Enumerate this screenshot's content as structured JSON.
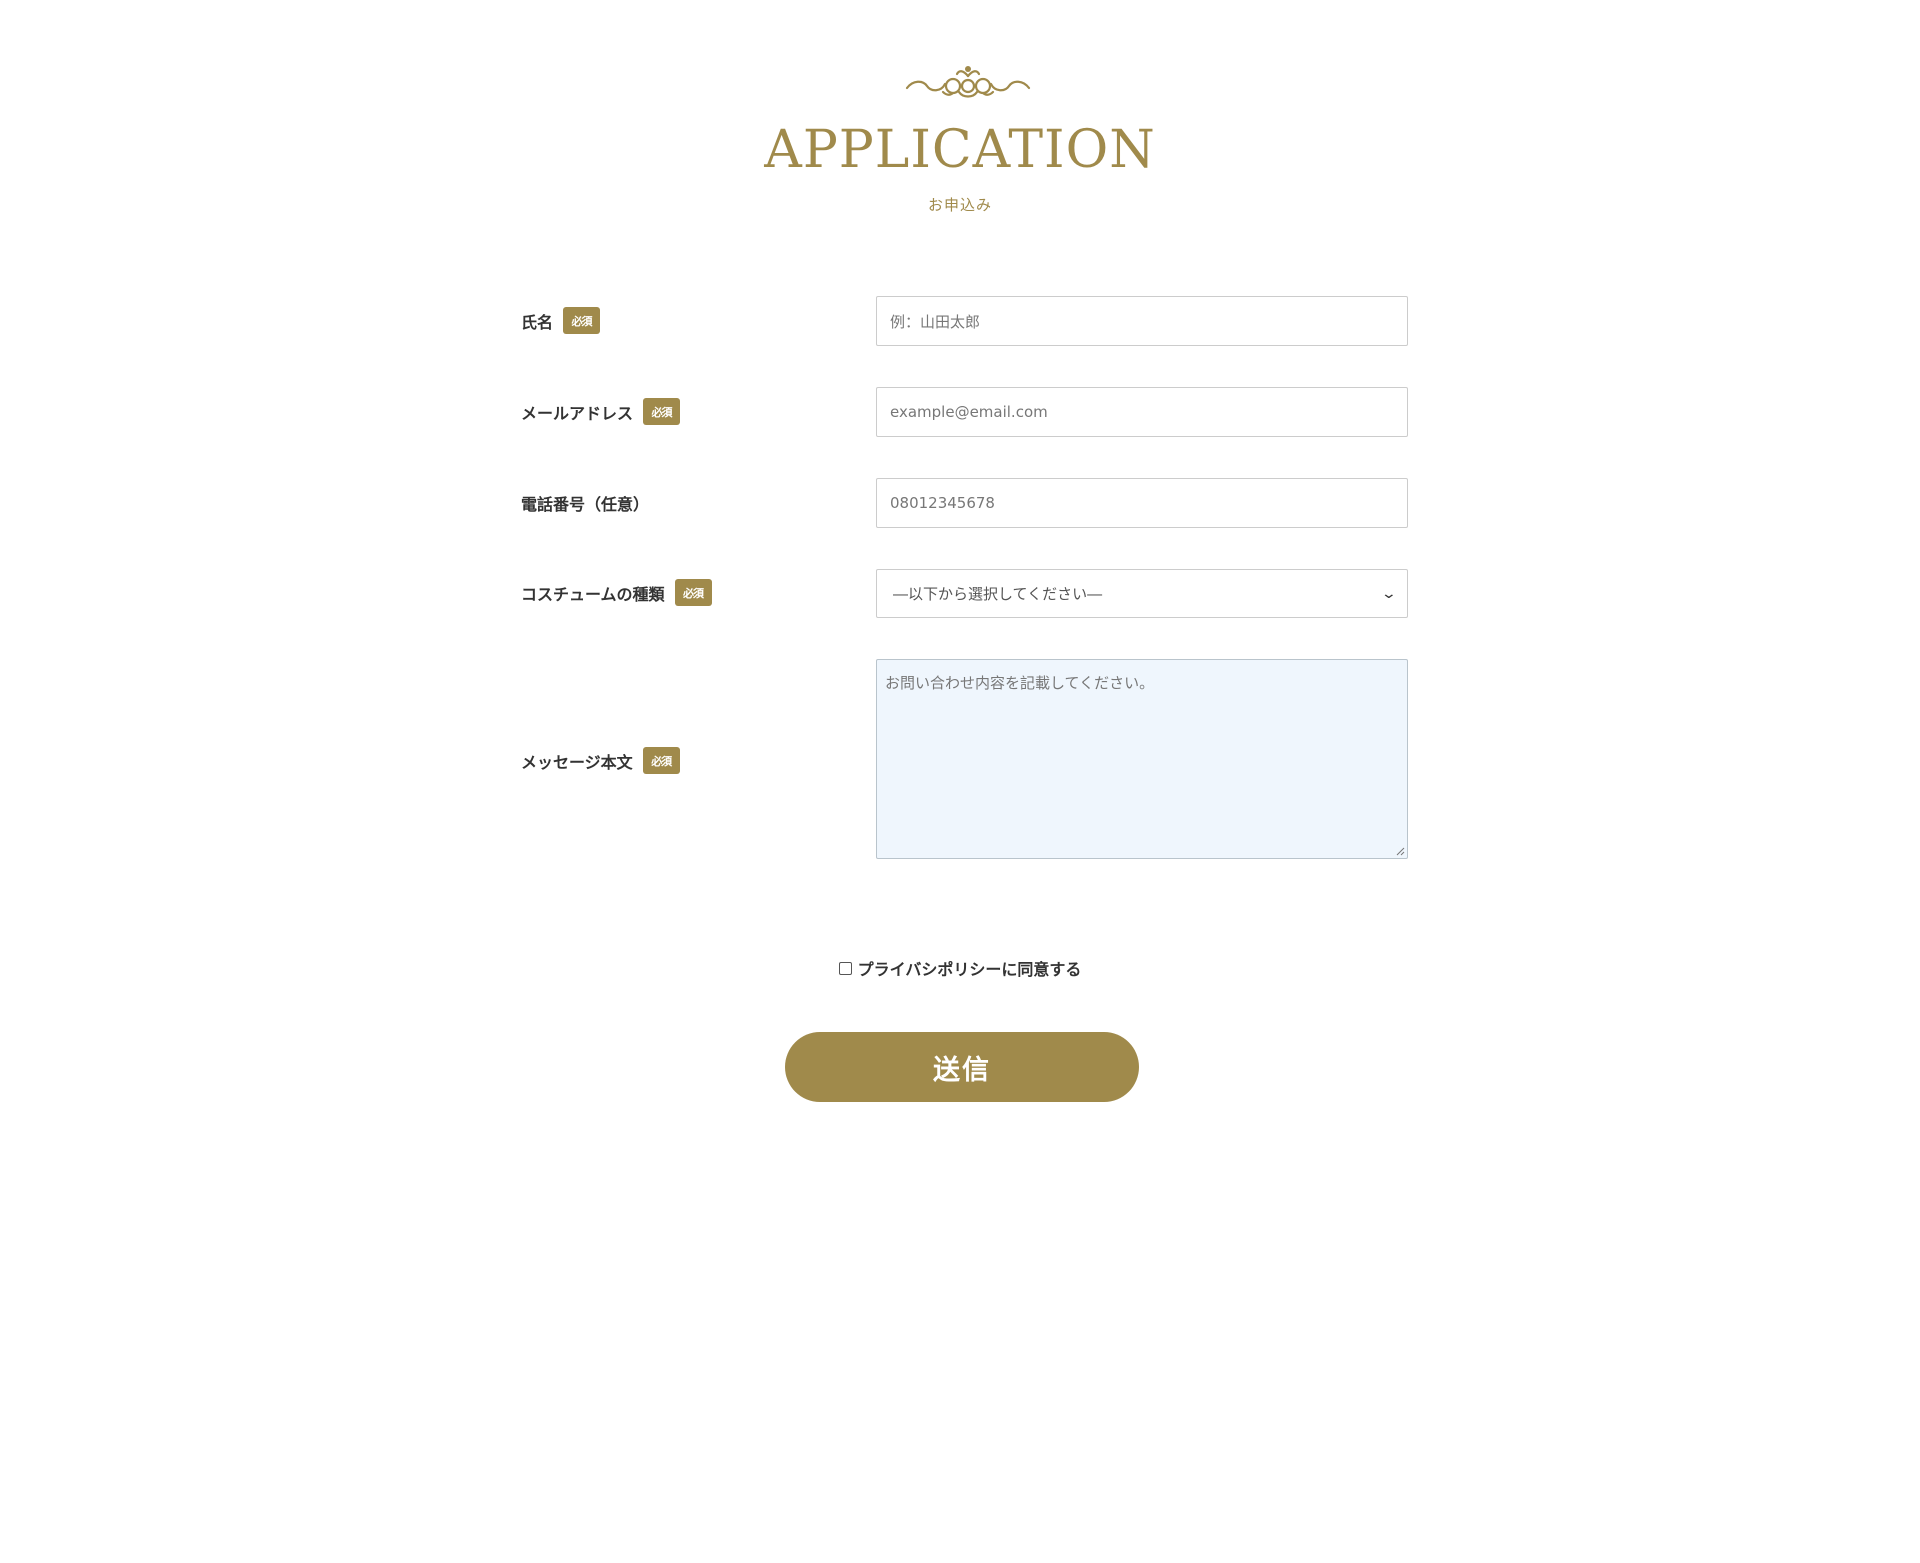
{
  "header": {
    "title": "APPLICATION",
    "subtitle": "お申込み"
  },
  "form": {
    "required_badge": "必須",
    "name": {
      "label": "氏名",
      "placeholder": "例：山田太郎"
    },
    "email": {
      "label": "メールアドレス",
      "placeholder": "example@email.com"
    },
    "phone": {
      "label": "電話番号（任意）",
      "placeholder": "08012345678"
    },
    "costume": {
      "label": "コスチュームの種類",
      "selected": "―以下から選択してください―"
    },
    "message": {
      "label": "メッセージ本文",
      "placeholder": "お問い合わせ内容を記載してください。"
    },
    "privacy_label": "プライバシポリシーに同意する",
    "submit_label": "送信"
  },
  "colors": {
    "accent": "#a08a4b",
    "textarea_bg": "#eff6fd"
  }
}
